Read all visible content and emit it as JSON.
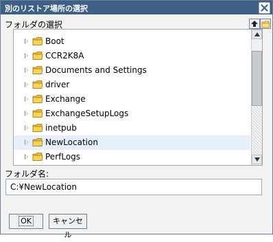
{
  "dialog": {
    "title": "別のリストア場所の選択",
    "close_icon": "close-icon"
  },
  "browser": {
    "section_label": "フォルダの選択",
    "up_icon": "up-arrow-icon",
    "new_folder_icon": "new-folder-icon",
    "folders": [
      {
        "label": "Boot"
      },
      {
        "label": "CCR2K8A"
      },
      {
        "label": "Documents and Settings"
      },
      {
        "label": "driver"
      },
      {
        "label": "Exchange"
      },
      {
        "label": "ExchangeSetupLogs"
      },
      {
        "label": "inetpub"
      },
      {
        "label": "NewLocation",
        "selected": true
      },
      {
        "label": "PerfLogs"
      }
    ]
  },
  "folder_name": {
    "label": "フォルダ名:",
    "value": "C:¥NewLocation"
  },
  "buttons": {
    "ok": "OK",
    "cancel": "キャンセル"
  },
  "colors": {
    "titlebar": "#3e5f86",
    "selected_row": "#e6f0fc",
    "folder_yellow": "#f6d35a"
  }
}
